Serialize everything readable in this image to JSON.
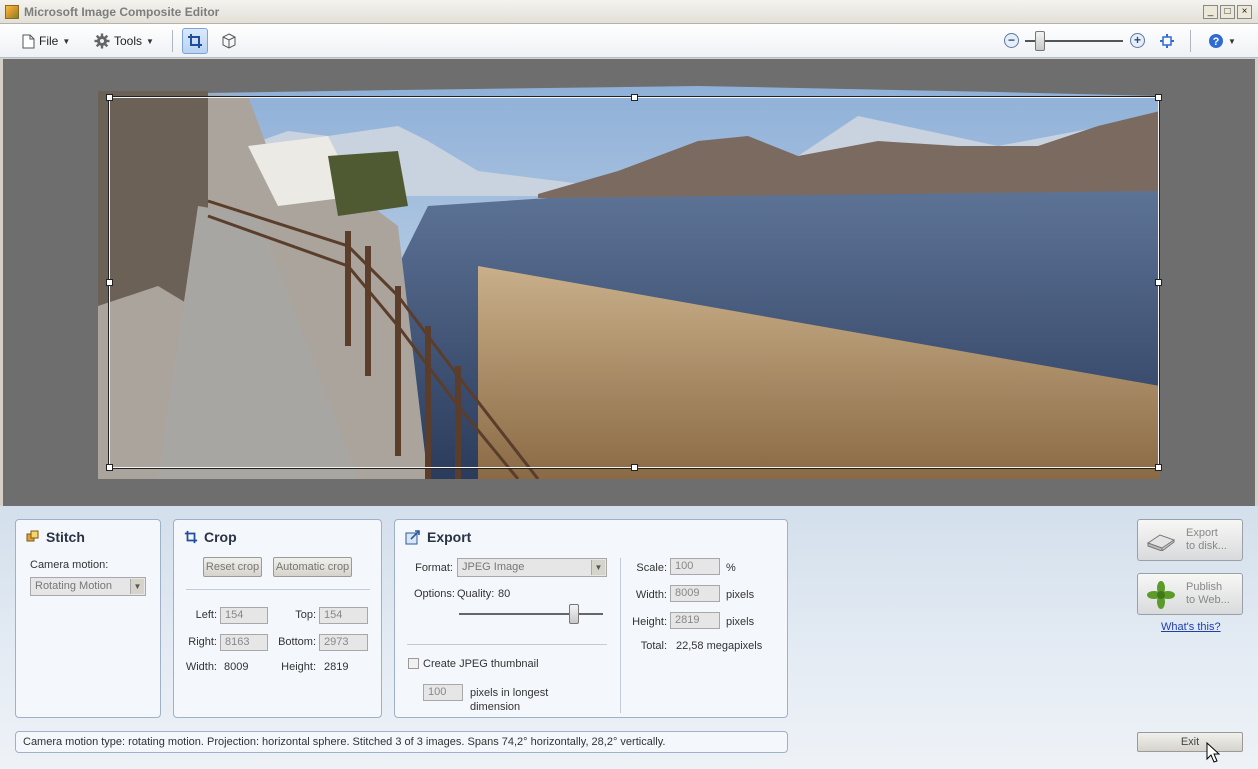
{
  "window": {
    "title": "Microsoft Image Composite Editor",
    "controls": [
      "minimize",
      "maximize",
      "close"
    ]
  },
  "toolbar": {
    "file_label": "File",
    "tools_label": "Tools",
    "zoom_out": "−",
    "zoom_in": "+",
    "zoom_level": 0.16
  },
  "stitch": {
    "title": "Stitch",
    "camera_motion_label": "Camera motion:",
    "camera_motion_value": "Rotating Motion"
  },
  "crop": {
    "title": "Crop",
    "reset_label": "Reset crop",
    "auto_label": "Automatic crop",
    "left_label": "Left:",
    "left_value": "154",
    "top_label": "Top:",
    "top_value": "154",
    "right_label": "Right:",
    "right_value": "8163",
    "bottom_label": "Bottom:",
    "bottom_value": "2973",
    "width_label": "Width:",
    "width_value": "8009",
    "height_label": "Height:",
    "height_value": "2819"
  },
  "export": {
    "title": "Export",
    "format_label": "Format:",
    "format_value": "JPEG Image",
    "options_label": "Options:",
    "quality_label": "Quality:",
    "quality_value": "80",
    "quality_fraction": 0.8,
    "thumbnail_label": "Create JPEG thumbnail",
    "thumbnail_checked": false,
    "thumb_pixels_value": "100",
    "thumb_pixels_label_1": "pixels in longest",
    "thumb_pixels_label_2": "dimension",
    "scale_label": "Scale:",
    "scale_value": "100",
    "scale_unit": "%",
    "width_label": "Width:",
    "width_value": "8009",
    "width_unit": "pixels",
    "height_label": "Height:",
    "height_value": "2819",
    "height_unit": "pixels",
    "total_label": "Total:",
    "total_value": "22,58 megapixels"
  },
  "actions": {
    "export_disk_1": "Export",
    "export_disk_2": "to disk...",
    "publish_web_1": "Publish",
    "publish_web_2": "to Web...",
    "whats_this": "What's this?",
    "exit_label": "Exit"
  },
  "status": "Camera motion type: rotating motion. Projection: horizontal sphere. Stitched 3 of 3 images. Spans 74,2° horizontally, 28,2° vertically.",
  "colors": {
    "canvas": "#6e6e6e",
    "panel_border": "#9fb1c8",
    "link": "#1f3fb0",
    "accent": "#2f6bd0"
  }
}
